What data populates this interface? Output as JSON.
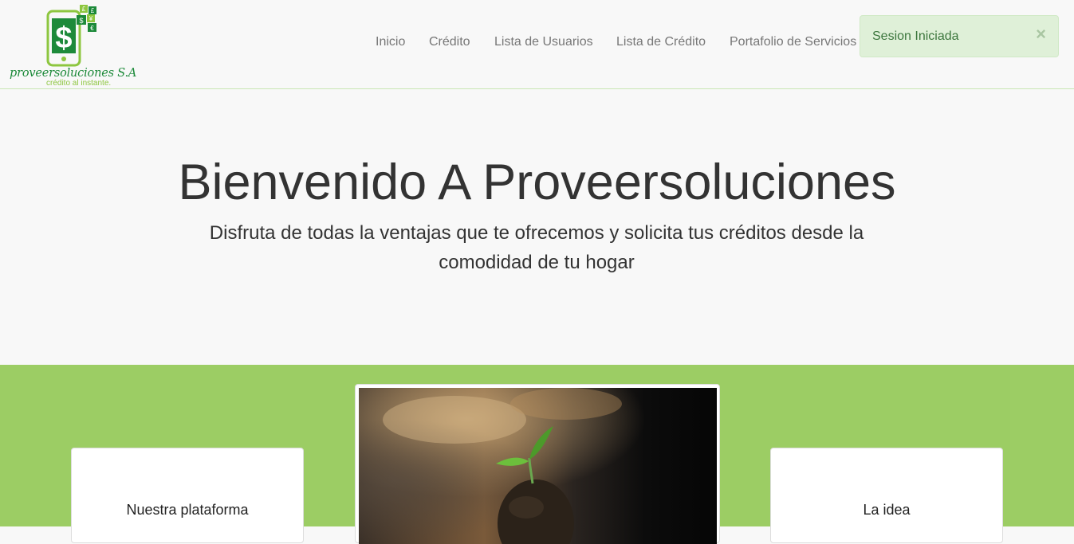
{
  "brand": {
    "name": "proveersoluciones S.A",
    "tagline": "crédito al instante.",
    "colors": {
      "primary_green": "#1d8a3a",
      "light_green": "#8dc63f"
    }
  },
  "nav": {
    "items": [
      {
        "label": "Inicio"
      },
      {
        "label": "Crédito"
      },
      {
        "label": "Lista de Usuarios"
      },
      {
        "label": "Lista de Crédito"
      },
      {
        "label": "Portafolio de Servicios"
      }
    ],
    "link_color": "#777777"
  },
  "alert": {
    "message": "Sesion Iniciada",
    "close_symbol": "×",
    "type": "success"
  },
  "hero": {
    "title": "Bienvenido A Proveersoluciones",
    "subtitle": "Disfruta de todas la ventajas que te ofrecemos y solicita tus créditos desde la comodidad de tu hogar"
  },
  "features": {
    "background": "#9ccd64",
    "cards": [
      {
        "title": "Nuestra plataforma"
      },
      {
        "title": "La idea"
      }
    ],
    "image": {
      "icon": "sprout-photo"
    }
  }
}
